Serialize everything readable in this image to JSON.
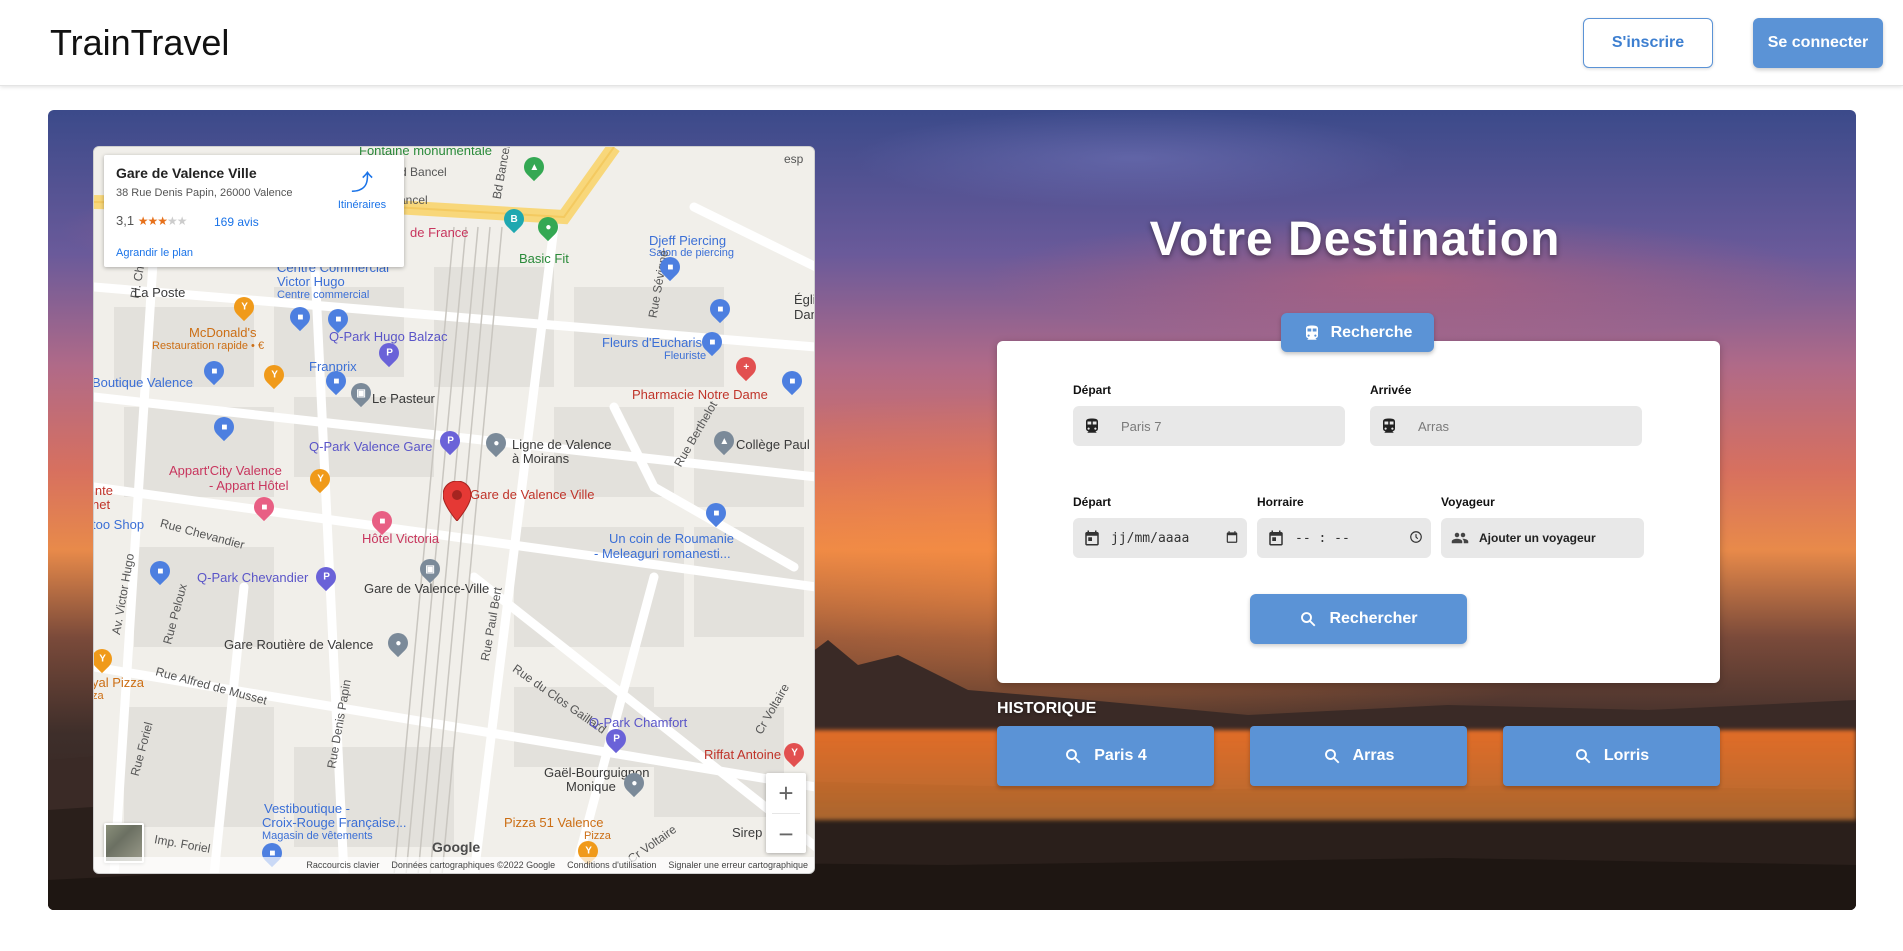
{
  "header": {
    "logo": "TrainTravel",
    "register_label": "S'inscrire",
    "login_label": "Se connecter"
  },
  "map": {
    "card": {
      "place": "Gare de Valence Ville",
      "address": "38 Rue Denis Papin, 26000 Valence",
      "rating": "3,1",
      "stars": "★★★",
      "stars_empty": "★★",
      "rating_value": 3.1,
      "reviews": "169 avis",
      "enlarge": "Agrandir le plan",
      "directions": "Itinéraires"
    },
    "labels": {
      "fontaine": "Fontaine monumentale",
      "bd_bancel_1": "Bd Bancel",
      "bd_bancel_2": "Bd Bancel",
      "bancel": "ancel",
      "de_france": "de France",
      "basic_fit": "Basic Fit",
      "djeff": "Djeff Piercing",
      "djeff_sub": "Salon de piercing",
      "esp": "esp",
      "centre_commercial": "Centre Commercial",
      "victor_hugo": "Victor Hugo",
      "centre_commercial_sub": "Centre commercial",
      "la_poste": "La Poste",
      "mcdonalds": "McDonald's",
      "mcdonalds_sub": "Restauration rapide • €",
      "qpark_balzac": "Q-Park Hugo Balzac",
      "fleurs": "Fleurs d'Eucharis",
      "fleurs_sub": "Fleuriste",
      "egli": "Égli",
      "dam": "Dam",
      "rue_sevigne": "Rue Sévigné",
      "pl_cham": "Pl. Cham",
      "boutique_valence": "Boutique Valence",
      "franprix": "Franprix",
      "le_pasteur": "Le Pasteur",
      "pharmacie": "Pharmacie Notre Dame",
      "qpark_gare": "Q-Park Valence Gare",
      "ligne_valence": "Ligne de Valence",
      "a_moirans": "à Moirans",
      "rue_berthelot": "Rue Berthelot",
      "college": "Collège Paul",
      "appart_city": "Appart'City Valence",
      "appart_hotel": "- Appart Hôtel",
      "gare_valence": "Gare de Valence Ville",
      "inte": "inte",
      "net": "net",
      "too_shop": "too Shop",
      "rue_chevandier": "Rue Chevandier",
      "hotel_victoria": "Hôtel Victoria",
      "coin_roumanie": "Un coin de Roumanie",
      "meleaguri": "- Meleaguri romanesti...",
      "av_victor_hugo": "Av. Victor Hugo",
      "qpark_chevandier": "Q-Park Chevandier",
      "gare_valence_ville2": "Gare de Valence-Ville",
      "rue_peloux": "Rue Peloux",
      "rue_paul_bert": "Rue Paul Bert",
      "gare_routiere": "Gare Routière de Valence",
      "rue_alfred": "Rue Alfred de Musset",
      "rue_clos_gaillard": "Rue du Clos Gaillard",
      "qpark_chamfort": "Q-Park Chamfort",
      "cr_voltaire": "Cr Voltaire",
      "riffat": "Riffat Antoine",
      "yal_pizza": "yal Pizza",
      "za": "za",
      "rue_foriel": "Rue Foriel",
      "rue_denis_papin": "Rue Denis Papin",
      "gael": "Gaël-Bourguignon",
      "monique": "Monique",
      "pizza_51": "Pizza 51 Valence",
      "pizza_sub": "Pizza",
      "cr_voltaire2": "Cr Voltaire",
      "sirep": "Sirep",
      "vestiboutique": "Vestiboutique -",
      "croix_rouge": "Croix-Rouge Française...",
      "magasin": "Magasin de vêtements",
      "imp_foriel": "Imp. Foriel"
    },
    "google": "Google",
    "footer": {
      "shortcuts": "Raccourcis clavier",
      "data": "Données cartographiques ©2022 Google",
      "terms": "Conditions d'utilisation",
      "report": "Signaler une erreur cartographique"
    },
    "zoom_in": "+",
    "zoom_out": "−"
  },
  "hero": {
    "title": "Votre Destination"
  },
  "search": {
    "tab_label": "Recherche",
    "departure_label": "Départ",
    "departure_placeholder": "Paris 7",
    "arrival_label": "Arrivée",
    "arrival_placeholder": "Arras",
    "date_label": "Départ",
    "date_value": "jj/mm/aaaa",
    "time_label": "Horraire",
    "time_value": "-- : --",
    "traveler_label": "Voyageur",
    "traveler_button": "Ajouter un voyageur",
    "submit_label": "Rechercher"
  },
  "history": {
    "title": "HISTORIQUE",
    "items": [
      "Paris 4",
      "Arras",
      "Lorris"
    ]
  },
  "colors": {
    "accent": "#5b93d6",
    "field_bg": "#e8e8e8",
    "marker_red": "#e53935"
  },
  "icons": {
    "train": "train-icon",
    "search": "search-icon",
    "calendar": "calendar-icon",
    "clock": "clock-icon",
    "people": "people-icon",
    "directions": "directions-icon",
    "location_marker": "location-marker-icon"
  }
}
